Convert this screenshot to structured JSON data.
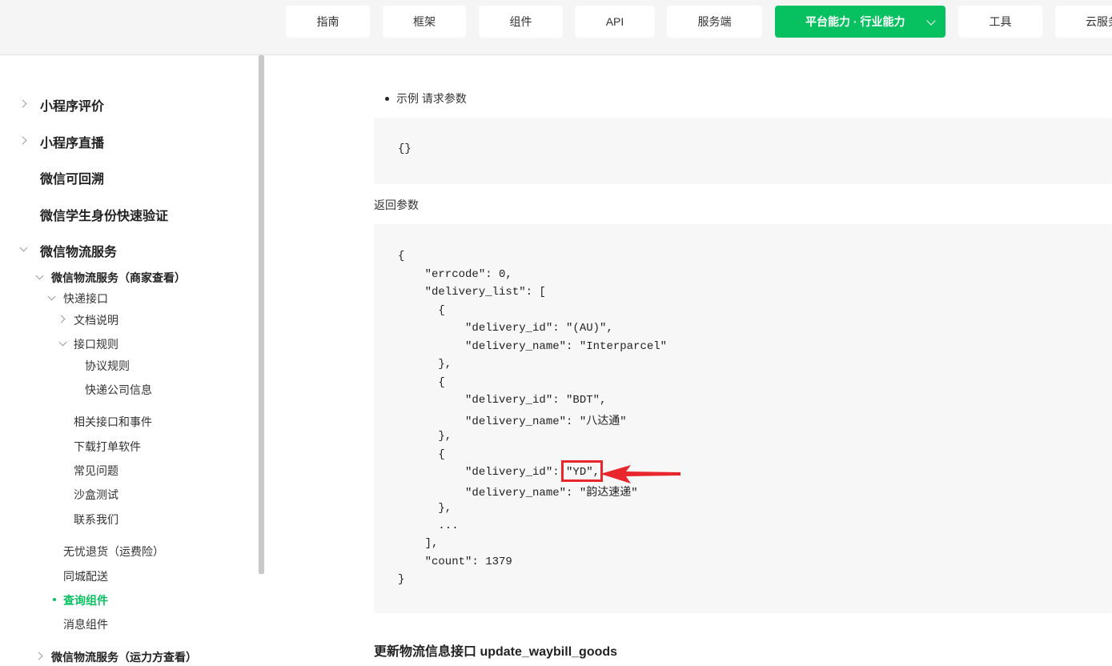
{
  "nav": {
    "items": [
      "指南",
      "框架",
      "组件",
      "API",
      "服务端",
      "工具",
      "云服务"
    ],
    "active": "平台能力 · 行业能力"
  },
  "sidebar": {
    "items": [
      {
        "label": "小程序评价"
      },
      {
        "label": "小程序直播"
      },
      {
        "label": "微信可回溯"
      },
      {
        "label": "微信学生身份快速验证"
      },
      {
        "label": "微信物流服务"
      },
      {
        "label": "微信物流服务（商家查看）"
      },
      {
        "label": "快递接口"
      },
      {
        "label": "文档说明"
      },
      {
        "label": "接口规则"
      },
      {
        "label": "协议规则"
      },
      {
        "label": "快递公司信息"
      },
      {
        "label": "相关接口和事件"
      },
      {
        "label": "下载打单软件"
      },
      {
        "label": "常见问题"
      },
      {
        "label": "沙盒测试"
      },
      {
        "label": "联系我们"
      },
      {
        "label": "无忧退货（运费险）"
      },
      {
        "label": "同城配送"
      },
      {
        "label": "查询组件"
      },
      {
        "label": "消息组件"
      },
      {
        "label": "微信物流服务（运力方查看）"
      }
    ]
  },
  "content": {
    "example_label": "示例 请求参数",
    "request_code": "{}",
    "return_label": "返回参数",
    "response_lines": [
      "{",
      "    \"errcode\": 0,",
      "    \"delivery_list\": [",
      "      {",
      "          \"delivery_id\": \"(AU)\",",
      "          \"delivery_name\": \"Interparcel\"",
      "      },",
      "      {",
      "          \"delivery_id\": \"BDT\",",
      "          \"delivery_name\": \"八达通\"",
      "      },",
      "      {",
      "          \"delivery_id\": \"YD\",",
      "          \"delivery_name\": \"韵达速递\"",
      "      },",
      "      ...",
      "    ],",
      "    \"count\": 1379",
      "}"
    ],
    "next_heading": "更新物流信息接口 update_waybill_goods"
  },
  "colors": {
    "accent": "#07c160",
    "annotation": "#e8262b",
    "code_bg": "#f7f7f7"
  }
}
